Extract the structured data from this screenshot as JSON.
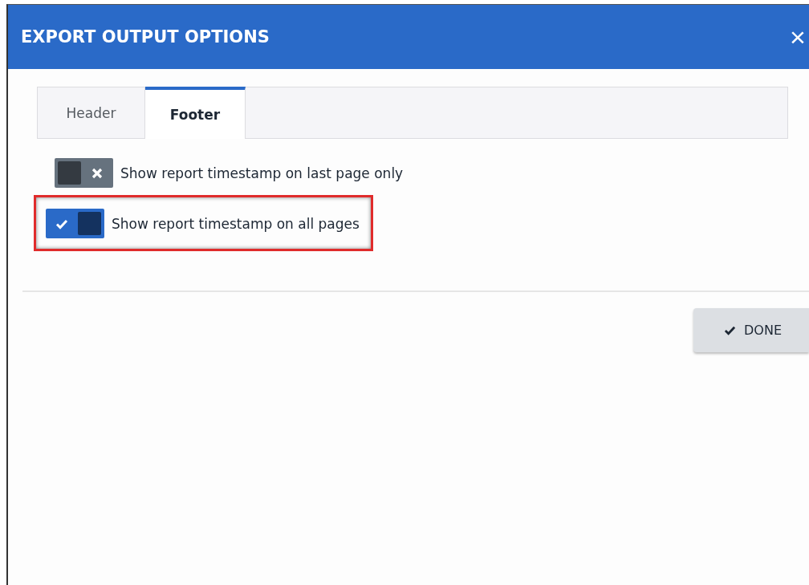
{
  "dialog": {
    "title": "EXPORT OUTPUT OPTIONS",
    "close": "×"
  },
  "tabs": [
    {
      "label": "Header",
      "selected": false
    },
    {
      "label": "Footer",
      "selected": true
    }
  ],
  "options": [
    {
      "label": "Show report timestamp on last page only",
      "on": false,
      "highlighted": false
    },
    {
      "label": "Show report timestamp on all pages",
      "on": true,
      "highlighted": true
    }
  ],
  "done_button": {
    "label": "DONE"
  }
}
